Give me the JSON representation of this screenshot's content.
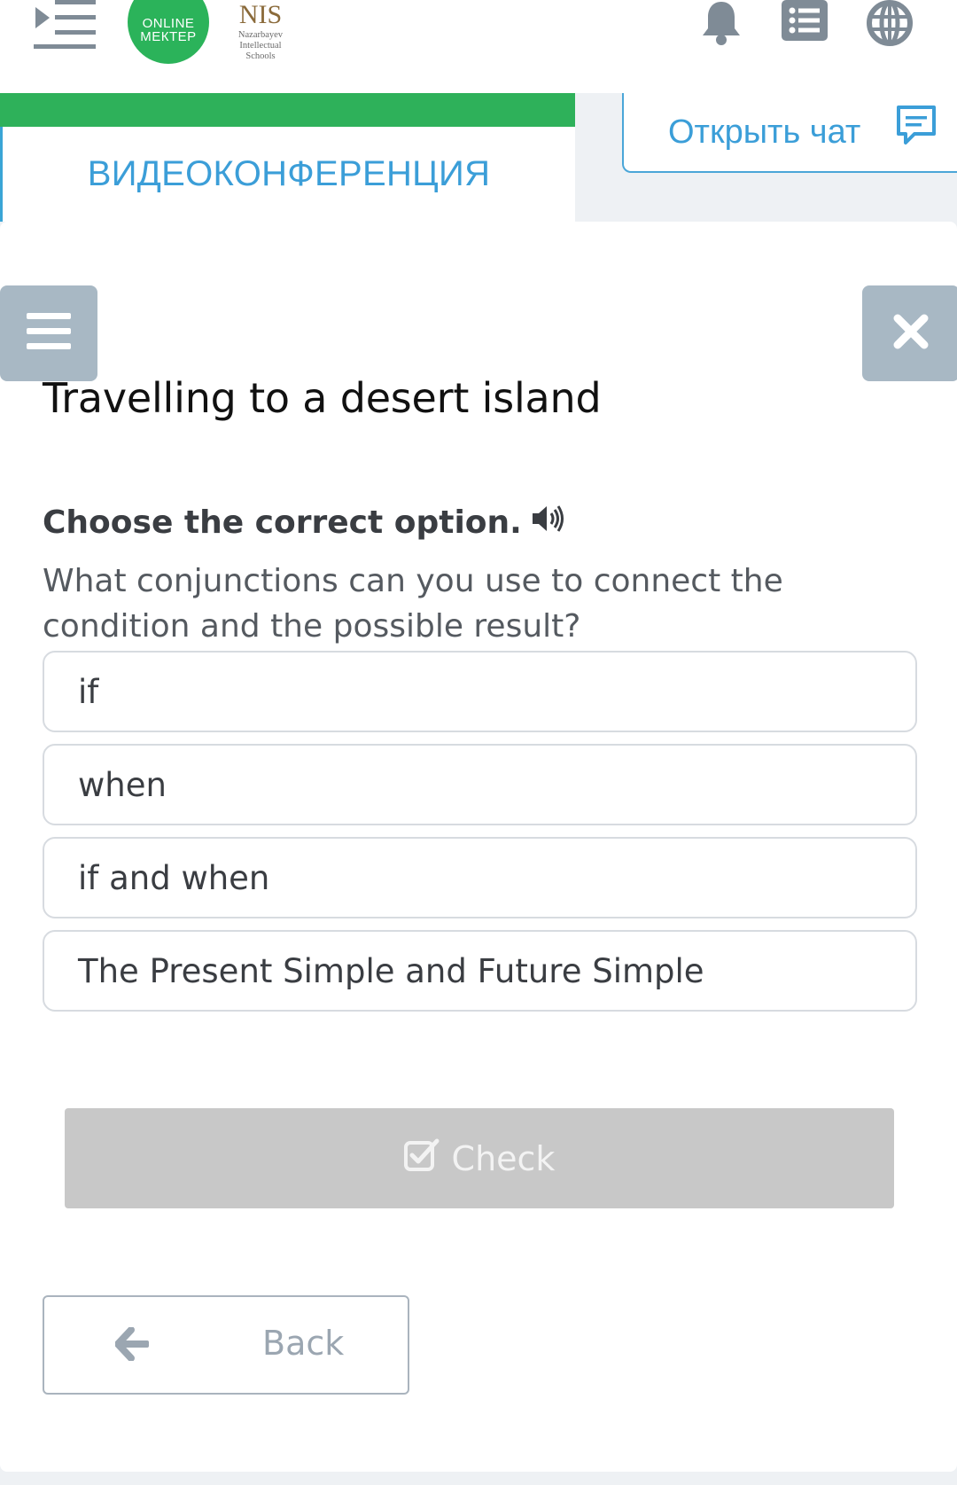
{
  "header": {
    "logo_online_line1": "ONLINE",
    "logo_online_line2": "МЕКТЕР",
    "logo_nis_main": "NIS",
    "logo_nis_line1": "Nazarbayev",
    "logo_nis_line2": "Intellectual",
    "logo_nis_line3": "Schools",
    "icons": [
      "menu-toggle-icon",
      "bell-icon",
      "list-icon",
      "globe-icon"
    ]
  },
  "nav": {
    "videoconference_label": "ВИДЕОКОНФЕРЕНЦИЯ",
    "open_chat_label": "Открыть чат"
  },
  "quiz": {
    "title": "Travelling to a desert island",
    "instruction": "Choose the correct option.",
    "question": "What conjunctions can you use to connect the condition and the possible result?",
    "options": [
      "if",
      "when",
      "if and when",
      "The Present Simple and Future Simple"
    ],
    "check_label": "Check",
    "back_label": "Back"
  },
  "colors": {
    "accent_green": "#2eb15a",
    "accent_blue": "#3b9ed8",
    "side_button_gray": "#a8b8c4",
    "check_button_gray": "#c8c8c8"
  }
}
